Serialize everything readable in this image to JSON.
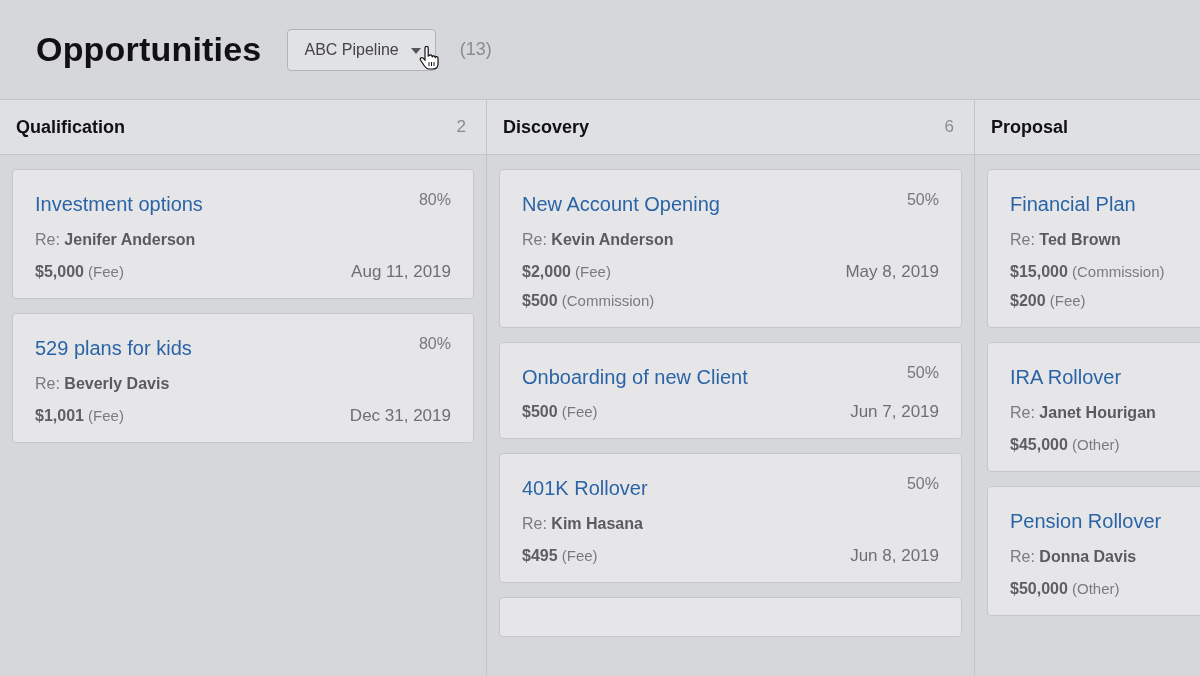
{
  "header": {
    "title": "Opportunities",
    "pipeline": "ABC Pipeline",
    "count": "(13)"
  },
  "columns": [
    {
      "name": "Qualification",
      "count": "2",
      "cards": [
        {
          "kind": "full",
          "title": "Investment options",
          "percent": "80%",
          "re_label": "Re:",
          "re_name": "Jenifer Anderson",
          "amounts": [
            {
              "value": "$5,000",
              "type": "(Fee)"
            }
          ],
          "date": "Aug 11, 2019"
        },
        {
          "kind": "full",
          "title": "529 plans for kids",
          "percent": "80%",
          "re_label": "Re:",
          "re_name": "Beverly Davis",
          "amounts": [
            {
              "value": "$1,001",
              "type": "(Fee)"
            }
          ],
          "date": "Dec 31, 2019"
        }
      ]
    },
    {
      "name": "Discovery",
      "count": "6",
      "cards": [
        {
          "kind": "full",
          "title": "New Account Opening",
          "percent": "50%",
          "re_label": "Re:",
          "re_name": "Kevin Anderson",
          "amounts": [
            {
              "value": "$2,000",
              "type": "(Fee)"
            },
            {
              "value": "$500",
              "type": "(Commission)"
            }
          ],
          "date": "May 8, 2019"
        },
        {
          "kind": "full",
          "title": "Onboarding of new Client",
          "percent": "50%",
          "amounts": [
            {
              "value": "$500",
              "type": "(Fee)"
            }
          ],
          "date": "Jun 7, 2019"
        },
        {
          "kind": "full",
          "title": "401K Rollover",
          "percent": "50%",
          "re_label": "Re:",
          "re_name": "Kim Hasana",
          "amounts": [
            {
              "value": "$495",
              "type": "(Fee)"
            }
          ],
          "date": "Jun 8, 2019"
        },
        {
          "kind": "partial"
        }
      ]
    },
    {
      "name": "Proposal",
      "cards": [
        {
          "kind": "full",
          "title": "Financial Plan",
          "re_label": "Re:",
          "re_name": "Ted Brown",
          "amounts": [
            {
              "value": "$15,000",
              "type": "(Commission)"
            },
            {
              "value": "$200",
              "type": "(Fee)"
            }
          ]
        },
        {
          "kind": "full",
          "title": "IRA Rollover",
          "re_label": "Re:",
          "re_name": "Janet Hourigan",
          "amounts": [
            {
              "value": "$45,000",
              "type": "(Other)"
            }
          ]
        },
        {
          "kind": "full",
          "title": "Pension Rollover",
          "re_label": "Re:",
          "re_name": "Donna Davis",
          "amounts": [
            {
              "value": "$50,000",
              "type": "(Other)"
            }
          ]
        }
      ]
    }
  ]
}
